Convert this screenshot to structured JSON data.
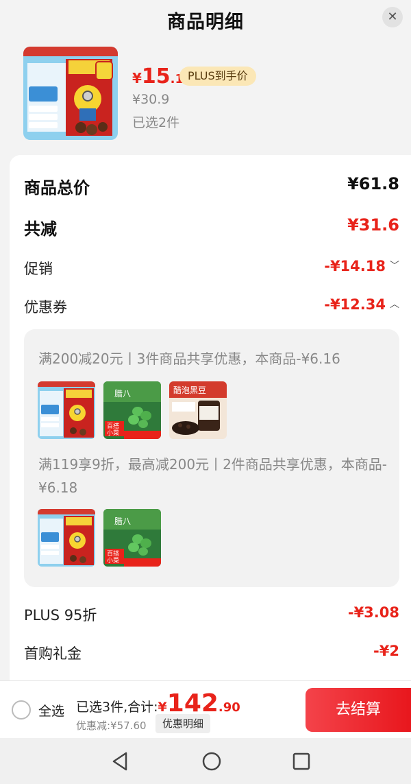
{
  "header": {
    "title": "商品明细",
    "close_icon": "close-icon"
  },
  "product": {
    "image_icon": "cereal-box-image",
    "price_symbol": "¥",
    "price_int": "15",
    "price_dec": ".1",
    "plus_tag": "PLUS到手价",
    "original_price": "¥30.9",
    "selected_count": "已选2件"
  },
  "summary": {
    "total_label": "商品总价",
    "total_value": "¥61.8",
    "reduce_label": "共减",
    "reduce_value": "¥31.6",
    "promo_label": "促销",
    "promo_value": "-¥14.18",
    "coupon_label": "优惠券",
    "coupon_value": "-¥12.34",
    "plus_label": "PLUS 95折",
    "plus_value": "-¥3.08",
    "gift_label": "首购礼金",
    "gift_value": "-¥2"
  },
  "coupons": [
    {
      "text": "满200减20元丨3件商品共享优惠，本商品-¥6.16",
      "thumbs": [
        "cereal-box-image",
        "green-beans-image",
        "black-bean-jar-image"
      ]
    },
    {
      "text": "满119享9折，最高减200元丨2件商品共享优惠，本商品-¥6.18",
      "thumbs": [
        "cereal-box-image",
        "green-beans-image"
      ]
    }
  ],
  "bottom": {
    "select_all": "全选",
    "sum_label": "已选3件,合计:",
    "sum_symbol": "¥",
    "sum_int": "142",
    "sum_dec": ".90",
    "discount_line": "优惠减:¥57.60",
    "detail_button": "优惠明细",
    "checkout_button": "去结算"
  },
  "colors": {
    "accent_red": "#e8231a",
    "plus_tag_bg": "#fbe7b6",
    "checkout_gradient_start": "#f4434a"
  },
  "nav": {
    "back_icon": "back-triangle-icon",
    "home_icon": "home-circle-icon",
    "recents_icon": "recents-square-icon"
  }
}
